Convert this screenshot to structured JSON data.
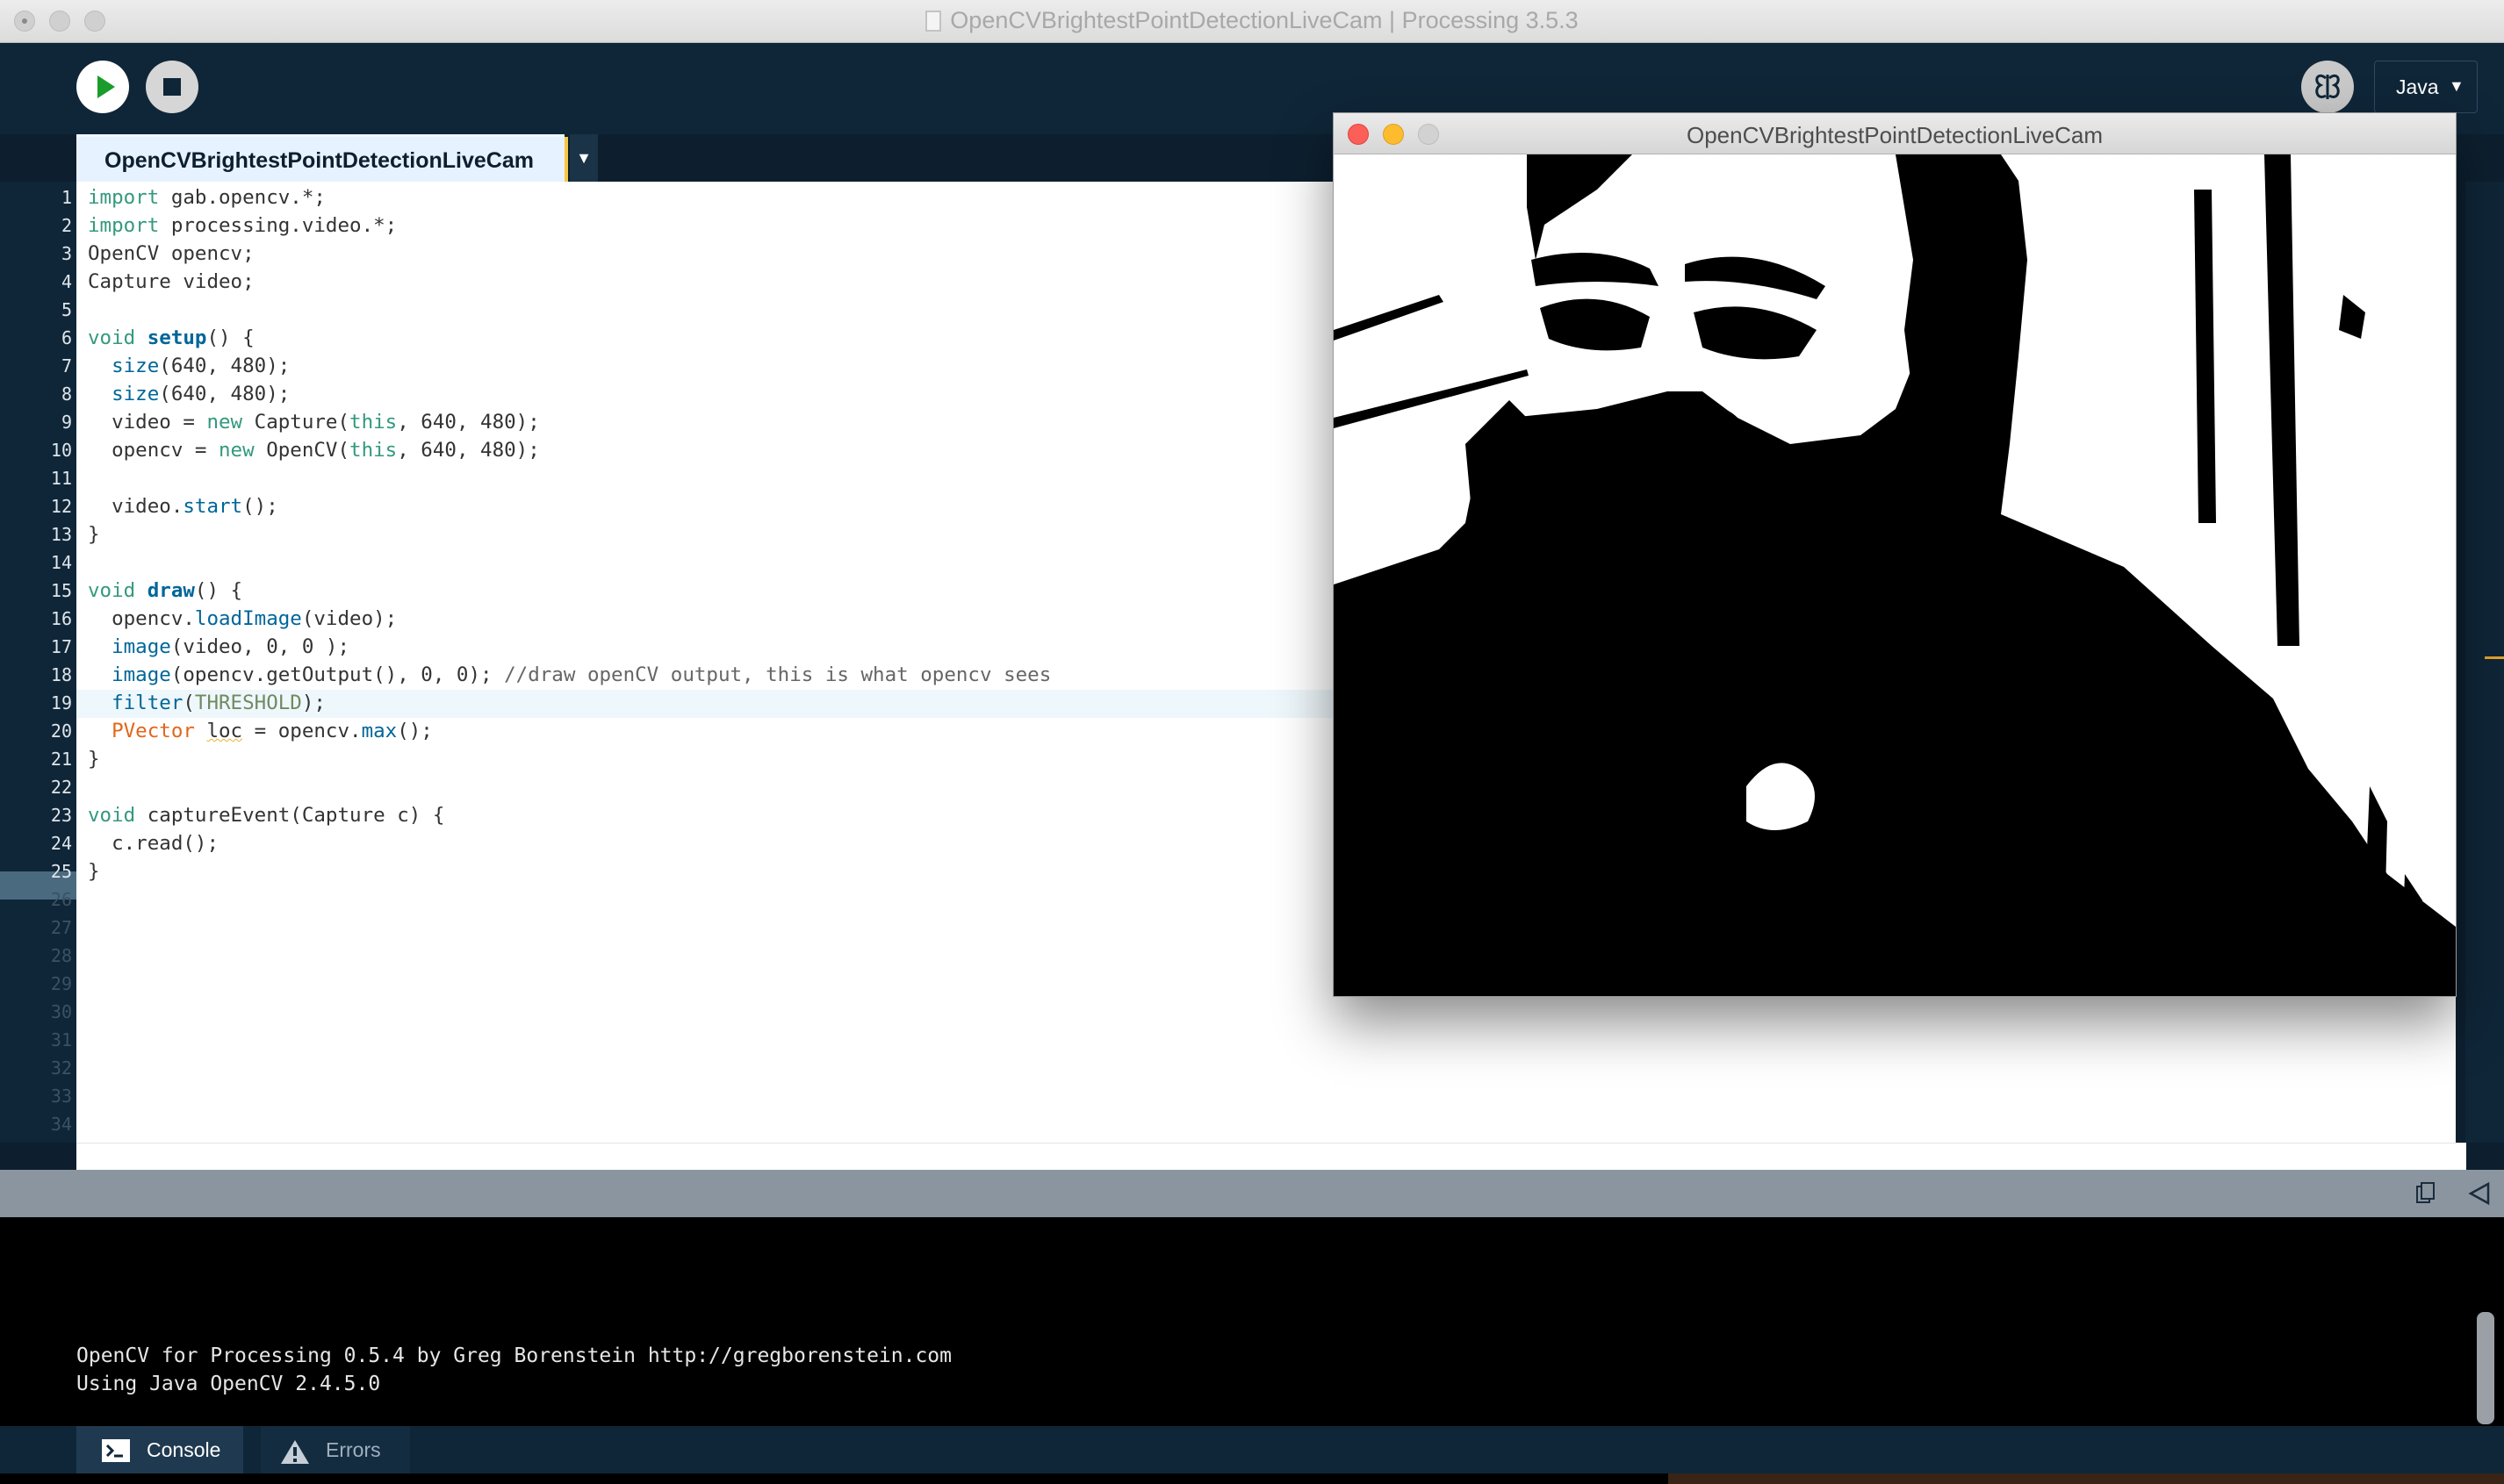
{
  "window": {
    "title": "OpenCVBrightestPointDetectionLiveCam | Processing 3.5.3"
  },
  "toolbar": {
    "run_icon": "play-icon",
    "stop_icon": "stop-icon",
    "debug_icon": "debugger-butterfly-icon",
    "mode_label": "Java",
    "mode_arrow": "▼"
  },
  "tabs": [
    {
      "label": "OpenCVBrightestPointDetectionLiveCam",
      "active": true
    }
  ],
  "tab_menu_arrow": "▼",
  "editor": {
    "current_line": 19,
    "line_numbers": [
      "1",
      "2",
      "3",
      "4",
      "5",
      "6",
      "7",
      "8",
      "9",
      "10",
      "11",
      "12",
      "13",
      "14",
      "15",
      "16",
      "17",
      "18",
      "19",
      "20",
      "21",
      "22",
      "23",
      "24",
      "25",
      "26",
      "27",
      "28",
      "29",
      "30",
      "31",
      "32",
      "33",
      "34"
    ],
    "lines": [
      "import gab.opencv.*;",
      "import processing.video.*;",
      "OpenCV opencv;",
      "Capture video;",
      "",
      "void setup() {",
      "  size(640, 480);",
      "  size(640, 480);",
      "  video = new Capture(this, 640, 480);",
      "  opencv = new OpenCV(this, 640, 480);",
      "",
      "  video.start();",
      "}",
      "",
      "void draw() {",
      "  opencv.loadImage(video);",
      "  image(video, 0, 0 );",
      "  image(opencv.getOutput(), 0, 0); //draw openCV output, this is what opencv sees",
      "  filter(THRESHOLD);",
      "  PVector loc = opencv.max();",
      "}",
      "",
      "void captureEvent(Capture c) {",
      "  c.read();",
      "}"
    ]
  },
  "sketch_window": {
    "title": "OpenCVBrightestPointDetectionLiveCam",
    "content": "thresholded-webcam-image"
  },
  "console": {
    "lines": [
      "OpenCV for Processing 0.5.4 by Greg Borenstein http://gregborenstein.com",
      "Using Java OpenCV 2.4.5.0"
    ]
  },
  "footer": {
    "console_label": "Console",
    "errors_label": "Errors"
  },
  "colors": {
    "chrome_dark": "#0f2638",
    "tab_active": "#e6f2ff",
    "keyword": "#33997e",
    "function": "#006699",
    "type": "#e2661a"
  }
}
